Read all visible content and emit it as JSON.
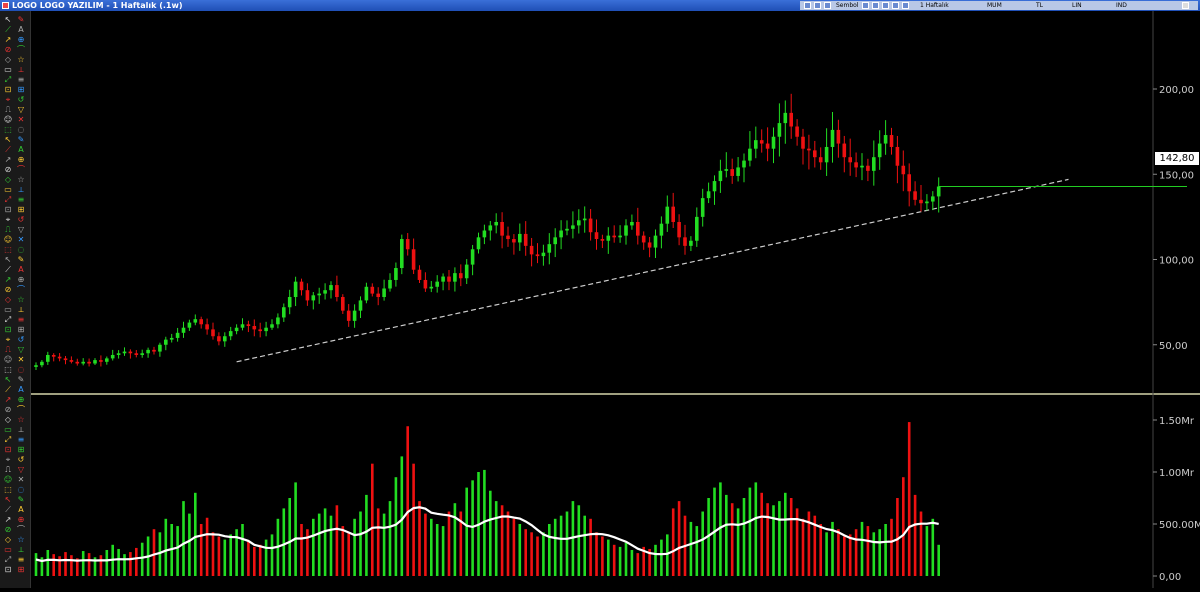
{
  "window": {
    "title": "LOGO LOGO YAZILIM - 1 Haftalık (.1w)"
  },
  "toolbar": {
    "period": "1 Haftalık",
    "candle_type": "MUM",
    "currency": "TL",
    "scale": "LIN",
    "indicator": "IND",
    "sym": "Sembol"
  },
  "price_label": "142,80",
  "colors": {
    "up": "#22dd22",
    "down": "#ee1111",
    "trendline": "#cccccc",
    "level_line": "#22cc22",
    "ma_line": "#ffffff",
    "axis_text": "#cccccc",
    "separator": "#ffffcc"
  },
  "chart_data": [
    {
      "type": "candlestick",
      "panel": "price",
      "ylim": [
        0,
        225
      ],
      "yticks": [
        50,
        100,
        150,
        200
      ],
      "ytick_labels": [
        "50,00",
        "100,00",
        "150,00",
        "200,00"
      ],
      "last_price": 142.8,
      "horizontal_level": 142.8,
      "trendline": {
        "start": {
          "index": 34,
          "value": 40
        },
        "end": {
          "index": 175,
          "value": 147
        }
      },
      "close": [
        38,
        40,
        44,
        43,
        42,
        41,
        40,
        39,
        40,
        39,
        41,
        40,
        42,
        44,
        45,
        46,
        45,
        44,
        45,
        47,
        46,
        50,
        53,
        54,
        57,
        60,
        63,
        65,
        62,
        59,
        55,
        52,
        55,
        58,
        60,
        62,
        61,
        59,
        58,
        60,
        62,
        66,
        72,
        78,
        87,
        82,
        76,
        79,
        80,
        82,
        85,
        78,
        70,
        64,
        70,
        76,
        84,
        80,
        78,
        83,
        88,
        95,
        112,
        106,
        94,
        88,
        83,
        84,
        87,
        90,
        87,
        92,
        89,
        97,
        106,
        113,
        117,
        120,
        122,
        114,
        112,
        110,
        115,
        108,
        103,
        102,
        104,
        109,
        113,
        117,
        118,
        120,
        123,
        124,
        116,
        112,
        111,
        114,
        113,
        114,
        120,
        122,
        114,
        110,
        107,
        114,
        121,
        131,
        122,
        113,
        108,
        111,
        125,
        136,
        140,
        146,
        152,
        153,
        149,
        154,
        158,
        165,
        170,
        168,
        165,
        172,
        180,
        186,
        178,
        172,
        165,
        164,
        160,
        157,
        166,
        176,
        168,
        160,
        157,
        154,
        155,
        152,
        160,
        168,
        173,
        166,
        155,
        150,
        140,
        135,
        133,
        134,
        137,
        142.8
      ],
      "volume_desc": "bar colors follow candle direction"
    },
    {
      "type": "bar",
      "panel": "volume",
      "ylim": [
        0,
        1.7
      ],
      "yticks": [
        0,
        0.5,
        1.0,
        1.5
      ],
      "ytick_labels": [
        "0,00",
        "500.00M",
        "1.00Mr",
        "1.50Mr"
      ],
      "values": [
        0.22,
        0.18,
        0.25,
        0.21,
        0.19,
        0.23,
        0.2,
        0.17,
        0.24,
        0.22,
        0.18,
        0.2,
        0.25,
        0.3,
        0.26,
        0.21,
        0.23,
        0.27,
        0.32,
        0.38,
        0.45,
        0.42,
        0.55,
        0.5,
        0.48,
        0.72,
        0.6,
        0.8,
        0.5,
        0.56,
        0.42,
        0.38,
        0.35,
        0.4,
        0.45,
        0.5,
        0.33,
        0.28,
        0.3,
        0.35,
        0.4,
        0.55,
        0.65,
        0.75,
        0.9,
        0.5,
        0.45,
        0.55,
        0.6,
        0.65,
        0.58,
        0.68,
        0.48,
        0.42,
        0.55,
        0.62,
        0.78,
        1.08,
        0.65,
        0.6,
        0.72,
        0.95,
        1.15,
        1.44,
        1.08,
        0.72,
        0.6,
        0.55,
        0.5,
        0.48,
        0.62,
        0.7,
        0.62,
        0.85,
        0.92,
        1.0,
        1.02,
        0.82,
        0.72,
        0.68,
        0.62,
        0.55,
        0.5,
        0.45,
        0.42,
        0.38,
        0.42,
        0.5,
        0.55,
        0.58,
        0.62,
        0.72,
        0.68,
        0.58,
        0.55,
        0.42,
        0.38,
        0.35,
        0.3,
        0.28,
        0.32,
        0.25,
        0.22,
        0.28,
        0.26,
        0.3,
        0.35,
        0.4,
        0.65,
        0.72,
        0.58,
        0.52,
        0.48,
        0.62,
        0.75,
        0.85,
        0.9,
        0.78,
        0.7,
        0.65,
        0.75,
        0.85,
        0.9,
        0.8,
        0.7,
        0.68,
        0.72,
        0.8,
        0.75,
        0.65,
        0.55,
        0.62,
        0.58,
        0.5,
        0.42,
        0.52,
        0.45,
        0.38,
        0.4,
        0.45,
        0.52,
        0.48,
        0.42,
        0.45,
        0.5,
        0.55,
        0.75,
        0.95,
        1.48,
        0.78,
        0.62,
        0.48,
        0.55
      ]
    }
  ]
}
